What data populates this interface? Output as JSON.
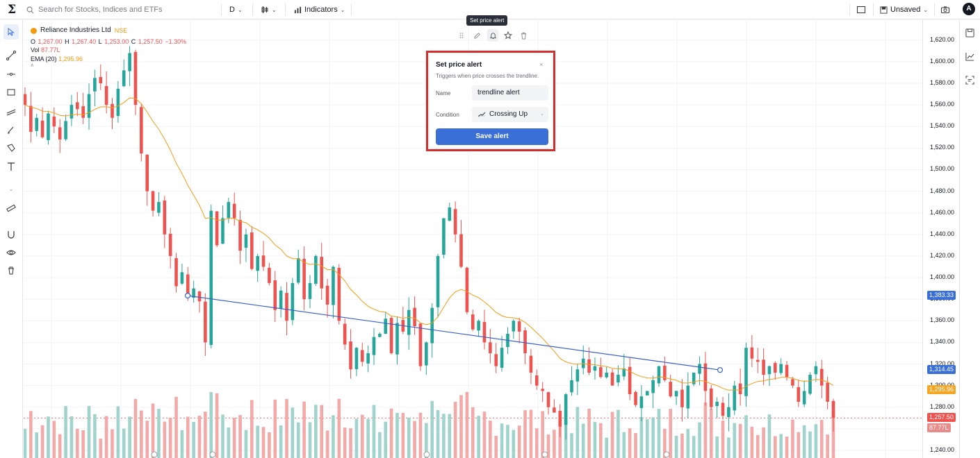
{
  "topbar": {
    "search_placeholder": "Search for Stocks, Indices and ETFs",
    "interval": "D",
    "indicators_label": "Indicators",
    "layout_label": "Unsaved",
    "avatar_initial": "A"
  },
  "legend": {
    "symbol": "Reliance Industries Ltd",
    "exchange": "NSE",
    "ohlc": {
      "o_label": "O",
      "o": "1,267.00",
      "h_label": "H",
      "h": "1,267.40",
      "l_label": "L",
      "l": "1,253.00",
      "c_label": "C",
      "c": "1,257.50",
      "change": "−1.30%"
    },
    "vol_label": "Vol",
    "vol_value": "87.77L",
    "ema_label": "EMA (20)",
    "ema_value": "1,295.96"
  },
  "floating_toolbar": {
    "tooltip": "Set price alert",
    "icons": [
      "drag-handle-icon",
      "pencil-icon",
      "bell-icon",
      "star-icon",
      "trash-icon"
    ]
  },
  "alert_dialog": {
    "title": "Set price alert",
    "subtitle": "Triggers when price crosses the trendline.",
    "name_label": "Name",
    "name_value": "trendline alert",
    "condition_label": "Condition",
    "condition_value": "Crossing Up",
    "save_label": "Save alert",
    "close": "×"
  },
  "price_scale": {
    "labels": [
      "1,620.00",
      "1,600.00",
      "1,580.00",
      "1,560.00",
      "1,540.00",
      "1,520.00",
      "1,500.00",
      "1,480.00",
      "1,460.00",
      "1,440.00",
      "1,420.00",
      "1,400.00",
      "1,380.00",
      "1,360.00",
      "1,340.00",
      "1,320.00",
      "1,300.00",
      "1,280.00",
      "1,240.00"
    ],
    "tags": [
      {
        "text": "1,383.33",
        "color": "#3a6fd8"
      },
      {
        "text": "1,314.45",
        "color": "#3a6fd8"
      },
      {
        "text": "1,295.96",
        "color": "#f5a623"
      },
      {
        "text": "1,257.50",
        "color": "#ef5350"
      },
      {
        "text": "87.77L",
        "color": "#e78b8b"
      }
    ]
  },
  "colors": {
    "up": "#26a69a",
    "down": "#ef5350",
    "ema": "#f39c12",
    "trendline": "#3a5fc8",
    "accent": "#3a6fd8"
  },
  "chart_data": {
    "type": "candlestick",
    "price_range": [
      1240,
      1625
    ],
    "ema_period": 20,
    "trendline": {
      "from": 1383.33,
      "to": 1314.45
    },
    "closes": [
      1560,
      1535,
      1548,
      1530,
      1552,
      1540,
      1528,
      1545,
      1560,
      1556,
      1548,
      1570,
      1585,
      1580,
      1560,
      1548,
      1575,
      1592,
      1608,
      1560,
      1515,
      1480,
      1462,
      1470,
      1440,
      1420,
      1392,
      1405,
      1382,
      1390,
      1378,
      1340,
      1462,
      1430,
      1455,
      1470,
      1455,
      1425,
      1440,
      1408,
      1420,
      1410,
      1395,
      1370,
      1388,
      1360,
      1395,
      1418,
      1380,
      1395,
      1420,
      1390,
      1375,
      1410,
      1360,
      1338,
      1315,
      1335,
      1322,
      1330,
      1345,
      1348,
      1362,
      1330,
      1358,
      1350,
      1370,
      1355,
      1318,
      1340,
      1372,
      1420,
      1455,
      1465,
      1440,
      1410,
      1368,
      1352,
      1360,
      1340,
      1330,
      1318,
      1335,
      1348,
      1360,
      1350,
      1330,
      1312,
      1300,
      1295,
      1280,
      1275,
      1262,
      1292,
      1305,
      1315,
      1325,
      1312,
      1318,
      1308,
      1312,
      1300,
      1310,
      1316,
      1292,
      1282,
      1290,
      1295,
      1305,
      1318,
      1305,
      1290,
      1295,
      1280,
      1300,
      1312,
      1320,
      1295,
      1280,
      1285,
      1272,
      1280,
      1300,
      1292,
      1335,
      1325,
      1322,
      1310,
      1318,
      1312,
      1320,
      1308,
      1300,
      1285,
      1295,
      1310,
      1318,
      1300,
      1285,
      1270
    ]
  }
}
